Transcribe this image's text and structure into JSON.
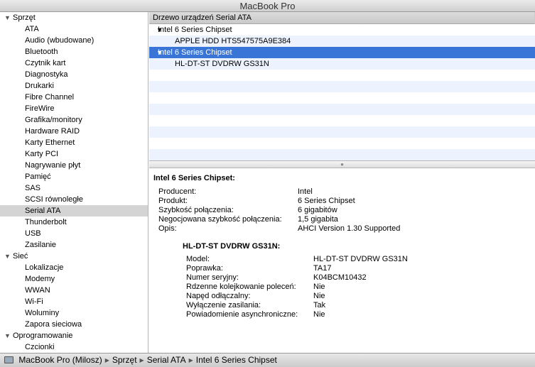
{
  "window": {
    "title": "MacBook Pro"
  },
  "sidebar": {
    "groups": [
      {
        "label": "Sprzęt",
        "items": [
          "ATA",
          "Audio (wbudowane)",
          "Bluetooth",
          "Czytnik kart",
          "Diagnostyka",
          "Drukarki",
          "Fibre Channel",
          "FireWire",
          "Grafika/monitory",
          "Hardware RAID",
          "Karty Ethernet",
          "Karty PCI",
          "Nagrywanie płyt",
          "Pamięć",
          "SAS",
          "SCSI równoległe",
          "Serial ATA",
          "Thunderbolt",
          "USB",
          "Zasilanie"
        ]
      },
      {
        "label": "Sieć",
        "items": [
          "Lokalizacje",
          "Modemy",
          "WWAN",
          "Wi-Fi",
          "Woluminy",
          "Zapora sieciowa"
        ]
      },
      {
        "label": "Oprogramowanie",
        "items": [
          "Czcionki"
        ]
      }
    ],
    "selected": "Serial ATA"
  },
  "tree": {
    "header": "Drzewo urządzeń Serial ATA",
    "rows": [
      {
        "label": "Intel 6 Series Chipset",
        "type": "parent"
      },
      {
        "label": "APPLE HDD HTS547575A9E384",
        "type": "child"
      },
      {
        "label": "Intel 6 Series Chipset",
        "type": "parent",
        "selected": true
      },
      {
        "label": "HL-DT-ST DVDRW  GS31N",
        "type": "child"
      }
    ]
  },
  "detail": {
    "title": "Intel 6 Series Chipset:",
    "props": [
      {
        "key": "Producent:",
        "value": "Intel"
      },
      {
        "key": "Produkt:",
        "value": "6 Series Chipset"
      },
      {
        "key": "Szybkość połączenia:",
        "value": "6 gigabitów"
      },
      {
        "key": "Negocjowana szybkość połączenia:",
        "value": "1,5 gigabita"
      },
      {
        "key": "Opis:",
        "value": "AHCI Version 1.30 Supported"
      }
    ],
    "device": {
      "title": "HL-DT-ST DVDRW  GS31N:",
      "props": [
        {
          "key": "Model:",
          "value": "HL-DT-ST DVDRW  GS31N"
        },
        {
          "key": "Poprawka:",
          "value": "TA17"
        },
        {
          "key": "Numer seryjny:",
          "value": "K04BCM10432"
        },
        {
          "key": "Rdzenne kolejkowanie poleceń:",
          "value": "Nie"
        },
        {
          "key": "Napęd odłączalny:",
          "value": "Nie"
        },
        {
          "key": "Wyłączenie zasilania:",
          "value": "Tak"
        },
        {
          "key": "Powiadomienie asynchroniczne:",
          "value": "Nie"
        }
      ]
    }
  },
  "pathbar": {
    "icon": "laptop-icon",
    "segments": [
      "MacBook Pro (Milosz)",
      "Sprzęt",
      "Serial ATA",
      "Intel 6 Series Chipset"
    ]
  }
}
